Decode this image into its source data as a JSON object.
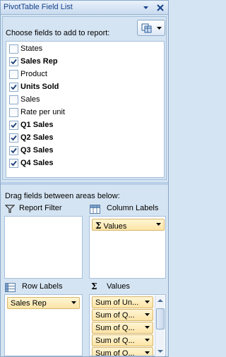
{
  "title": "PivotTable Field List",
  "choose_label": "Choose fields to add to report:",
  "fields": [
    {
      "label": "States",
      "checked": false,
      "bold": false
    },
    {
      "label": "Sales Rep",
      "checked": true,
      "bold": true
    },
    {
      "label": "Product",
      "checked": false,
      "bold": false
    },
    {
      "label": "Units Sold",
      "checked": true,
      "bold": true
    },
    {
      "label": "Sales",
      "checked": false,
      "bold": false
    },
    {
      "label": "Rate per unit",
      "checked": false,
      "bold": false
    },
    {
      "label": "Q1 Sales",
      "checked": true,
      "bold": true
    },
    {
      "label": "Q2 Sales",
      "checked": true,
      "bold": true
    },
    {
      "label": "Q3 Sales",
      "checked": true,
      "bold": true
    },
    {
      "label": "Q4 Sales",
      "checked": true,
      "bold": true
    }
  ],
  "drag_label": "Drag fields between areas below:",
  "areas": {
    "report_filter": {
      "label": "Report Filter",
      "icon": "filter-icon"
    },
    "column_labels": {
      "label": "Column Labels",
      "icon": "column-labels-icon",
      "chips": [
        "Values"
      ]
    },
    "row_labels": {
      "label": "Row Labels",
      "icon": "row-labels-icon",
      "chips": [
        "Sales Rep"
      ]
    },
    "values": {
      "label": "Values",
      "icon": "sigma-icon",
      "chips": [
        "Sum of Un...",
        "Sum of Q...",
        "Sum of Q...",
        "Sum of Q...",
        "Sum of Q..."
      ]
    }
  },
  "colors": {
    "chip": "#fce4a6",
    "pane": "#d5e4f2",
    "border": "#a5bfdc"
  }
}
